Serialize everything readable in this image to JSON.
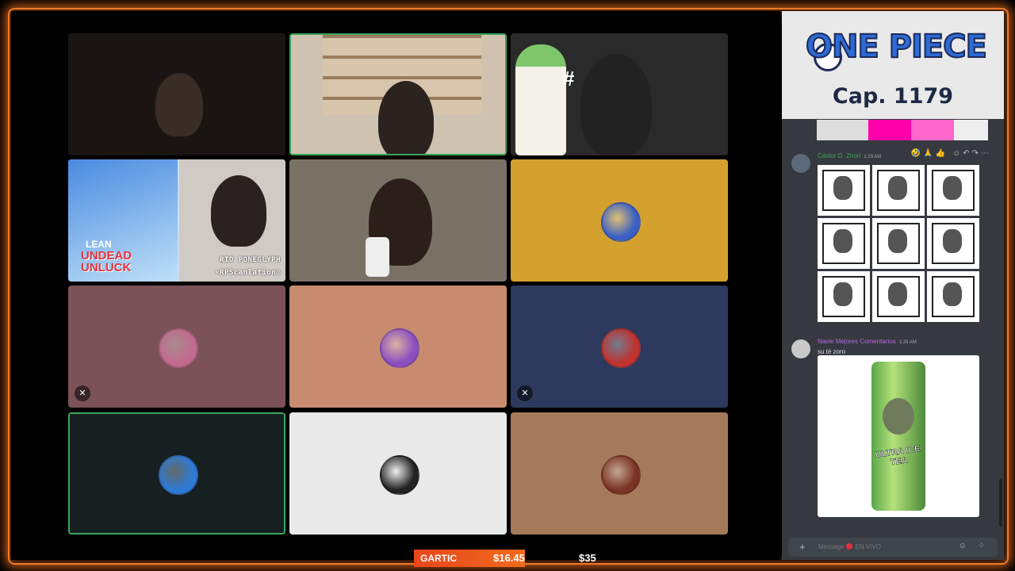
{
  "app": {
    "logo_text": "ONE PIECE",
    "chapter": "Cap. 1179"
  },
  "tiles": [
    {
      "id": "tile-1",
      "kind": "camera",
      "bg": "#1a1512",
      "speaking": false
    },
    {
      "id": "tile-2",
      "kind": "camera",
      "bg": "#cfc2b0",
      "speaking": true
    },
    {
      "id": "tile-3",
      "kind": "camera",
      "bg": "#2a2a2a",
      "speaking": false
    },
    {
      "id": "tile-4",
      "kind": "cover",
      "bg": "#c9def2",
      "speaking": false
    },
    {
      "id": "tile-5",
      "kind": "camera",
      "bg": "#7a7165",
      "speaking": false
    },
    {
      "id": "tile-6",
      "kind": "avatar",
      "bg": "#d4a12e",
      "avatar_color": "#3b5fc4",
      "speaking": false,
      "muted": false
    },
    {
      "id": "tile-7",
      "kind": "avatar",
      "bg": "#7b5257",
      "avatar_color": "#c36a8e",
      "speaking": false,
      "muted": true
    },
    {
      "id": "tile-8",
      "kind": "avatar",
      "bg": "#c98b70",
      "avatar_color": "#8a4fc0",
      "speaking": false,
      "muted": false
    },
    {
      "id": "tile-9",
      "kind": "avatar",
      "bg": "#2d3a5d",
      "avatar_color": "#c0332f",
      "speaking": false,
      "muted": true
    },
    {
      "id": "tile-10",
      "kind": "avatar",
      "bg": "#162020",
      "avatar_color": "#2e7ad6",
      "speaking": true,
      "muted": false
    },
    {
      "id": "tile-11",
      "kind": "avatar",
      "bg": "#e9e9e9",
      "avatar_color": "#222222",
      "speaking": false,
      "muted": false
    },
    {
      "id": "tile-12",
      "kind": "avatar",
      "bg": "#a57a5a",
      "avatar_color": "#7a3324",
      "speaking": false,
      "muted": false
    }
  ],
  "cover": {
    "lean": "LEAN",
    "title_line1": "UNDEAD",
    "title_line2": "UNLUCK",
    "credit1": "RIO PONEGLYPH",
    "credit2": "✕RPScanlation◎"
  },
  "chat": {
    "messages": [
      {
        "user": "Cástor D. Zhori",
        "time": "1:29 AM",
        "user_color": "#3ba55c",
        "text": ""
      },
      {
        "user": "Navie Mejores Comentarios",
        "time": "1:29 AM",
        "user_color": "#b36ae2",
        "text": "su té zoro"
      }
    ],
    "message_toolbar": "🤣🙏👍 ☺↶↷⋯",
    "can_label": "ULTRA ICE TEA",
    "input_placeholder_pre": "Message",
    "input_placeholder_post": "EN VIVO",
    "input_icons": "☺ ⁘"
  },
  "ticker": {
    "name": "GARTIC",
    "amount_1": "$16.45",
    "amount_2": "$35"
  },
  "colors": {
    "frame": "#f07a2a",
    "speaking_border": "#3ba55c",
    "panel_bg": "#36393f"
  }
}
